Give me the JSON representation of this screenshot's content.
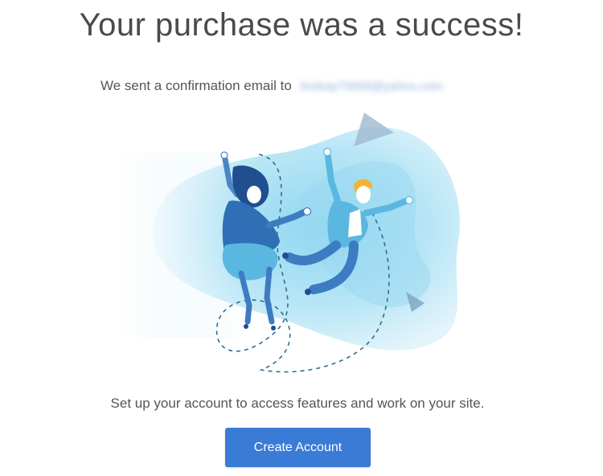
{
  "header": {
    "title": "Your purchase was a success!"
  },
  "confirmation": {
    "prefix": "We sent a confirmation email to",
    "email_redacted": "lindsay75656@yahoo.com"
  },
  "illustration": {
    "icon": "celebrating-people-illustration"
  },
  "cta": {
    "description": "Set up your account to access features and work on your site.",
    "button_label": "Create Account",
    "button_color": "#3a7bd5"
  },
  "colors": {
    "blob_light": "#dff2fb",
    "blob_mid": "#a9dff3",
    "figure_blue": "#2f6fb5",
    "figure_light": "#5ab8e0"
  }
}
